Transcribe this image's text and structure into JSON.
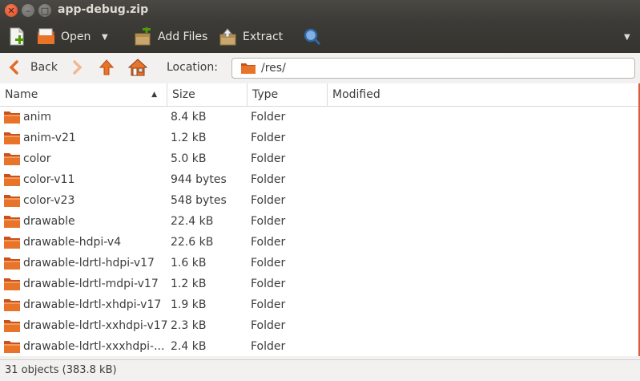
{
  "window": {
    "title": "app-debug.zip"
  },
  "toolbar": {
    "open_label": "Open",
    "add_files_label": "Add Files",
    "extract_label": "Extract"
  },
  "nav": {
    "back_label": "Back",
    "location_label": "Location:",
    "location_value": "/res/"
  },
  "columns": {
    "name": "Name",
    "size": "Size",
    "type": "Type",
    "modified": "Modified"
  },
  "rows": [
    {
      "name": "anim",
      "size": "8.4 kB",
      "type": "Folder",
      "modified": ""
    },
    {
      "name": "anim-v21",
      "size": "1.2 kB",
      "type": "Folder",
      "modified": ""
    },
    {
      "name": "color",
      "size": "5.0 kB",
      "type": "Folder",
      "modified": ""
    },
    {
      "name": "color-v11",
      "size": "944 bytes",
      "type": "Folder",
      "modified": ""
    },
    {
      "name": "color-v23",
      "size": "548 bytes",
      "type": "Folder",
      "modified": ""
    },
    {
      "name": "drawable",
      "size": "22.4 kB",
      "type": "Folder",
      "modified": ""
    },
    {
      "name": "drawable-hdpi-v4",
      "size": "22.6 kB",
      "type": "Folder",
      "modified": ""
    },
    {
      "name": "drawable-ldrtl-hdpi-v17",
      "size": "1.6 kB",
      "type": "Folder",
      "modified": ""
    },
    {
      "name": "drawable-ldrtl-mdpi-v17",
      "size": "1.2 kB",
      "type": "Folder",
      "modified": ""
    },
    {
      "name": "drawable-ldrtl-xhdpi-v17",
      "size": "1.9 kB",
      "type": "Folder",
      "modified": ""
    },
    {
      "name": "drawable-ldrtl-xxhdpi-v17",
      "size": "2.3 kB",
      "type": "Folder",
      "modified": ""
    },
    {
      "name": "drawable-ldrtl-xxxhdpi-...",
      "size": "2.4 kB",
      "type": "Folder",
      "modified": ""
    }
  ],
  "status": {
    "text": "31 objects (383.8 kB)"
  },
  "colors": {
    "titlebar": "#3c3b37",
    "close": "#e04e22",
    "folder": "#e8742a",
    "accent": "#e05a3a"
  }
}
